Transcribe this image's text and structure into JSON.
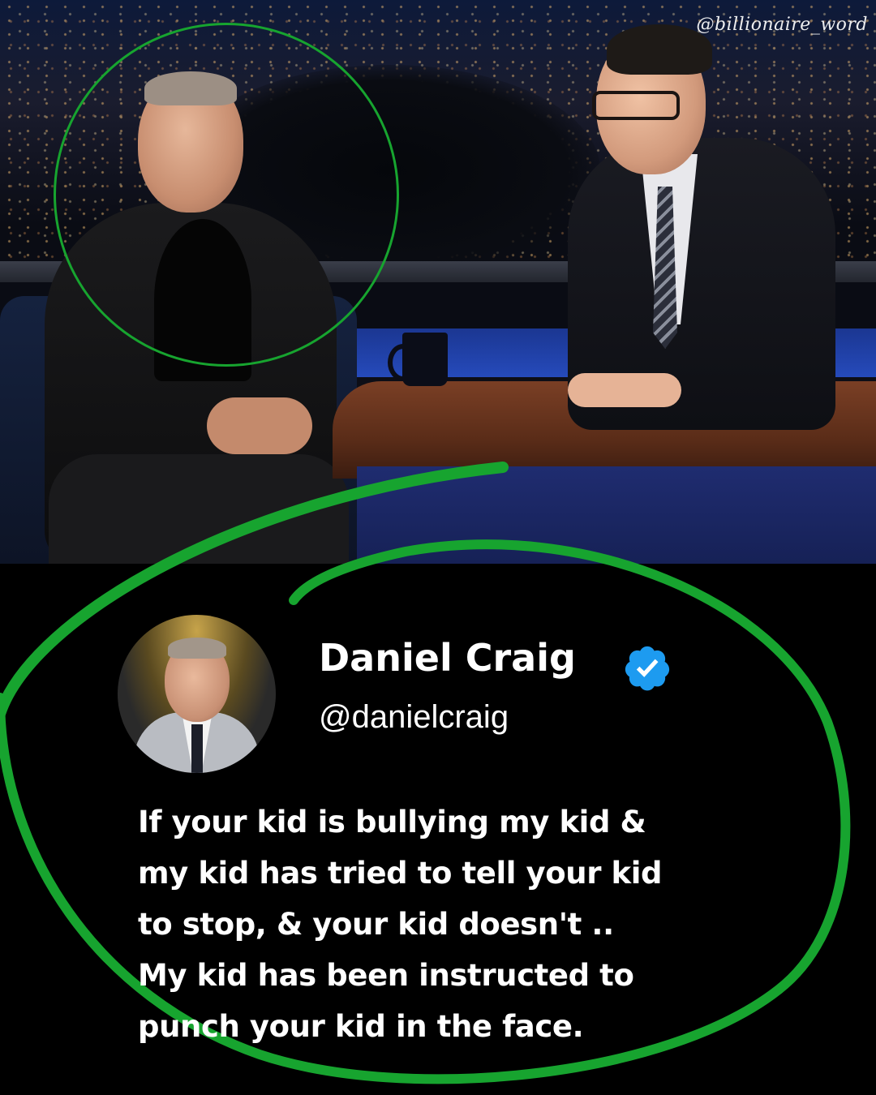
{
  "watermark": "@billionaire_word",
  "photo": {
    "subject_icon": "talk-show-photo"
  },
  "colors": {
    "accent_green": "#17a42f",
    "verified_blue": "#1d9bf0",
    "card_background": "#000000",
    "text": "#ffffff"
  },
  "tweet": {
    "display_name": "Daniel Craig",
    "handle": "@danielcraig",
    "verified_icon": "verified-check-icon",
    "text_lines": [
      "If your kid is bullying my kid &",
      "my kid has tried to tell your kid",
      "to stop, & your kid doesn't ..",
      "My kid has been instructed to",
      "punch your kid in the face."
    ]
  }
}
